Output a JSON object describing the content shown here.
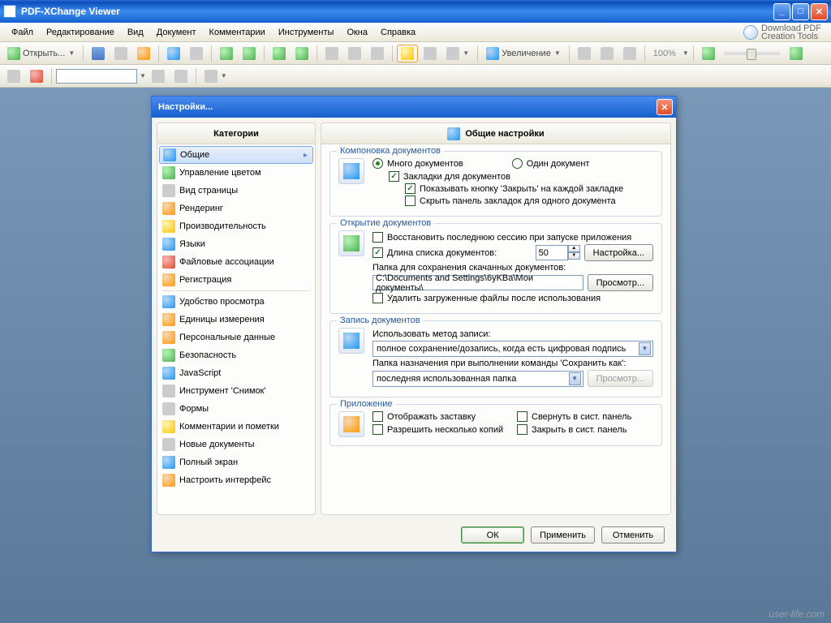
{
  "app": {
    "title": "PDF-XChange Viewer"
  },
  "menu": {
    "file": "Файл",
    "edit": "Редактирование",
    "view": "Вид",
    "doc": "Документ",
    "comments": "Комментарии",
    "tools": "Инструменты",
    "windows": "Окна",
    "help": "Справка"
  },
  "download_badge": {
    "line1": "Download PDF",
    "line2": "Creation Tools"
  },
  "toolbar": {
    "open": "Открыть...",
    "zoom": "Увеличение",
    "zoom_pct": "100%"
  },
  "dialog": {
    "title": "Настройки...",
    "cat_header": "Категории",
    "set_header": "Общие настройки",
    "categories": {
      "general": "Общие",
      "color": "Управление цветом",
      "pageview": "Вид страницы",
      "render": "Рендеринг",
      "perf": "Производительность",
      "lang": "Языки",
      "assoc": "Файловые ассоциации",
      "reg": "Регистрация",
      "browse": "Удобство просмотра",
      "units": "Единицы измерения",
      "personal": "Персональные данные",
      "security": "Безопасность",
      "js": "JavaScript",
      "snapshot": "Инструмент 'Снимок'",
      "forms": "Формы",
      "annot": "Комментарии и пометки",
      "newdoc": "Новые документы",
      "fullscreen": "Полный экран",
      "customize": "Настроить интерфейс"
    },
    "grp1": {
      "title": "Компоновка документов",
      "r1": "Много документов",
      "r2": "Один документ",
      "c1": "Закладки для документов",
      "c2": "Показывать кнопку 'Закрыть' на каждой закладке",
      "c3": "Скрыть панель закладок для одного документа"
    },
    "grp2": {
      "title": "Открытие документов",
      "c1": "Восстановить последнюю сессию при запуске приложения",
      "c2": "Длина списка документов:",
      "spin": "50",
      "btn1": "Настройка...",
      "lbl1": "Папка для сохранения скачанных документов:",
      "path": "C:\\Documents and Settings\\6yKBa\\Мои документы\\",
      "btn2": "Просмотр...",
      "c3": "Удалить загруженные файлы после использования"
    },
    "grp3": {
      "title": "Запись документов",
      "lbl1": "Использовать метод записи:",
      "combo1": "полное сохранение/дозапись, когда есть цифровая подпись",
      "lbl2": "Папка назначения при выполнении команды 'Сохранить как':",
      "combo2": "последняя использованная папка",
      "btn1": "Просмотр..."
    },
    "grp4": {
      "title": "Приложение",
      "c1": "Отображать заставку",
      "c2": "Свернуть в сист. панель",
      "c3": "Разрешить несколько копий",
      "c4": "Закрыть в сист. панель"
    },
    "btns": {
      "ok": "ОК",
      "apply": "Применить",
      "cancel": "Отменить"
    }
  },
  "watermark": "user-life.com"
}
